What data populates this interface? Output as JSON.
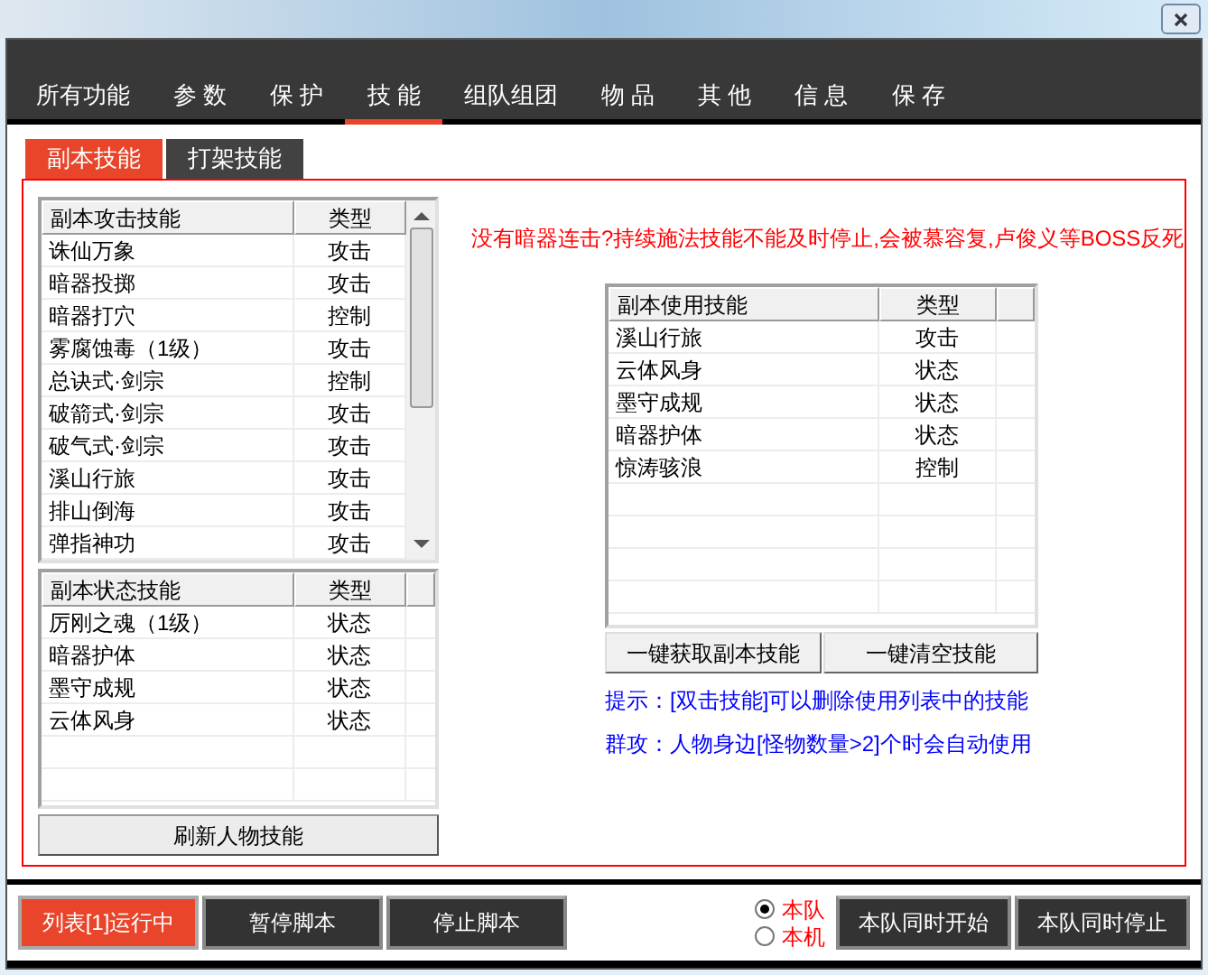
{
  "nav_tabs": [
    {
      "label": "所有功能",
      "selected": false
    },
    {
      "label": "参 数",
      "selected": false
    },
    {
      "label": "保 护",
      "selected": false
    },
    {
      "label": "技 能",
      "selected": true
    },
    {
      "label": "组队组团",
      "selected": false
    },
    {
      "label": "物 品",
      "selected": false
    },
    {
      "label": "其 他",
      "selected": false
    },
    {
      "label": "信 息",
      "selected": false
    },
    {
      "label": "保 存",
      "selected": false
    }
  ],
  "sub_tabs": [
    {
      "label": "副本技能",
      "selected": true
    },
    {
      "label": "打架技能",
      "selected": false
    }
  ],
  "attack_skills": {
    "columns": [
      "副本攻击技能",
      "类型"
    ],
    "rows": [
      {
        "name": "诛仙万象",
        "type": "攻击"
      },
      {
        "name": "暗器投掷",
        "type": "攻击"
      },
      {
        "name": "暗器打穴",
        "type": "控制"
      },
      {
        "name": "雾腐蚀毒（1级）",
        "type": "攻击"
      },
      {
        "name": "总诀式·剑宗",
        "type": "控制"
      },
      {
        "name": "破箭式·剑宗",
        "type": "攻击"
      },
      {
        "name": "破气式·剑宗",
        "type": "攻击"
      },
      {
        "name": "溪山行旅",
        "type": "攻击"
      },
      {
        "name": "排山倒海",
        "type": "攻击"
      },
      {
        "name": "弹指神功",
        "type": "攻击"
      }
    ]
  },
  "status_skills": {
    "columns": [
      "副本状态技能",
      "类型"
    ],
    "rows": [
      {
        "name": "厉刚之魂（1级）",
        "type": "状态"
      },
      {
        "name": "暗器护体",
        "type": "状态"
      },
      {
        "name": "墨守成规",
        "type": "状态"
      },
      {
        "name": "云体风身",
        "type": "状态"
      }
    ]
  },
  "refresh_button": "刷新人物技能",
  "warning": "没有暗器连击?持续施法技能不能及时停止,会被慕容复,卢俊义等BOSS反死",
  "used_skills": {
    "columns": [
      "副本使用技能",
      "类型"
    ],
    "rows": [
      {
        "name": "溪山行旅",
        "type": "攻击"
      },
      {
        "name": "云体风身",
        "type": "状态"
      },
      {
        "name": "墨守成规",
        "type": "状态"
      },
      {
        "name": "暗器护体",
        "type": "状态"
      },
      {
        "name": "惊涛骇浪",
        "type": "控制"
      }
    ]
  },
  "used_buttons": [
    "一键获取副本技能",
    "一键清空技能"
  ],
  "hints": [
    "提示：[双击技能]可以删除使用列表中的技能",
    "群攻：人物身边[怪物数量>2]个时会自动使用"
  ],
  "bottom_bar": {
    "status_button": "列表[1]运行中",
    "script_buttons": [
      "暂停脚本",
      "停止脚本"
    ],
    "scope_options": [
      {
        "label": "本队",
        "selected": true
      },
      {
        "label": "本机",
        "selected": false
      }
    ],
    "team_buttons": [
      "本队同时开始",
      "本队同时停止"
    ]
  }
}
